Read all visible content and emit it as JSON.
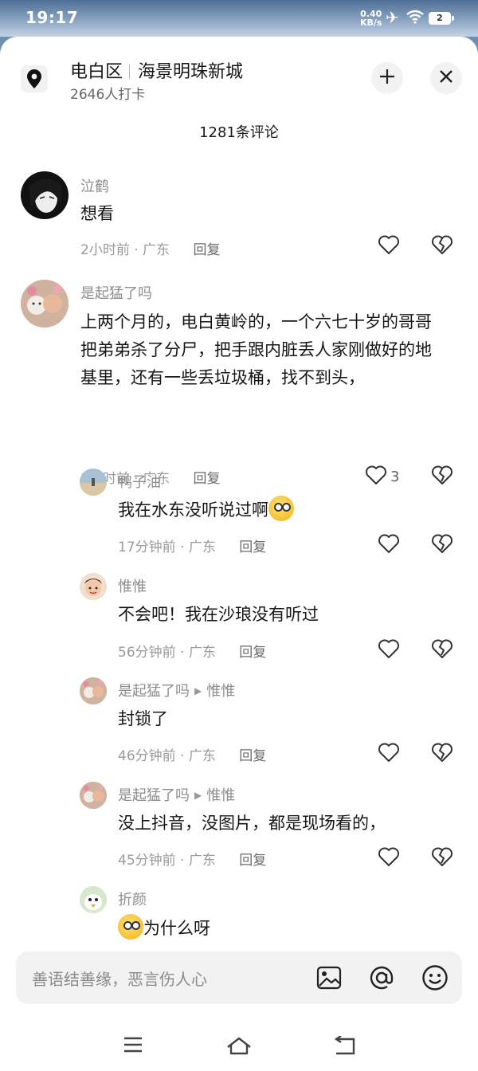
{
  "status": {
    "time": "19:17",
    "net_speed": "0.40",
    "net_unit": "KB/s",
    "battery": "2"
  },
  "header": {
    "district": "电白区",
    "place": "海景明珠新城",
    "checkins": "2646人打卡",
    "icons": [
      "location-pin-icon",
      "collapse-icon",
      "close-icon"
    ]
  },
  "comments_count": "1281条评论",
  "comments": [
    {
      "name": "泣鹤",
      "text": "想看",
      "time": "2小时前",
      "region": "广东",
      "reply_label": "回复",
      "likes": ""
    },
    {
      "name": "是起猛了吗",
      "text": "上两个月的，电白黄岭的，一个六七十岁的哥哥把弟弟杀了分尸，把手跟内脏丢人家刚做好的地基里，还有一些丢垃圾桶，找不到头，",
      "time": "1小时前",
      "region": "广东",
      "reply_label": "回复",
      "likes": "3"
    }
  ],
  "replies": [
    {
      "name": "鸭子油",
      "reply_to": "",
      "text": "我在水东没听说过啊",
      "time": "17分钟前",
      "region": "广东",
      "reply_label": "回复"
    },
    {
      "name": "惟惟",
      "reply_to": "",
      "text": "不会吧！我在沙琅没有听过",
      "time": "56分钟前",
      "region": "广东",
      "reply_label": "回复"
    },
    {
      "name": "是起猛了吗",
      "reply_to": "惟惟",
      "text": "封锁了",
      "time": "46分钟前",
      "region": "广东",
      "reply_label": "回复"
    },
    {
      "name": "是起猛了吗",
      "reply_to": "惟惟",
      "text": "没上抖音，没图片，都是现场看的，",
      "time": "45分钟前",
      "region": "广东",
      "reply_label": "回复"
    },
    {
      "name": "折颜",
      "reply_to": "",
      "text": "为什么呀",
      "time": "",
      "region": "",
      "reply_label": ""
    }
  ],
  "separator": "·",
  "input": {
    "placeholder": "善语结善缘，恶言伤人心",
    "icons": [
      "image-icon",
      "at-icon",
      "emoji-icon"
    ]
  },
  "navbar": {
    "icons": [
      "menu-icon",
      "home-icon",
      "back-icon"
    ]
  }
}
